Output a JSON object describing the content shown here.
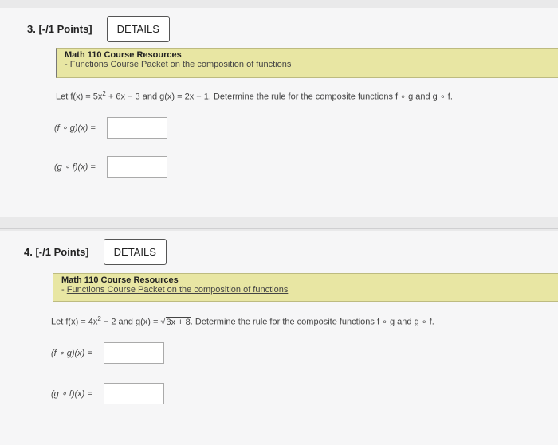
{
  "questions": [
    {
      "number": "3.",
      "points": "[-/1 Points]",
      "details_label": "DETAILS",
      "resources_title": "Math 110 Course Resources",
      "resources_prefix": "- ",
      "resources_link": "Functions Course Packet on the composition of functions",
      "prompt_pre": "Let f(x) = 5x",
      "prompt_sup": "2",
      "prompt_mid": " + 6x − 3 and g(x) = 2x − 1. Determine the rule for the composite functions f ∘ g and g ∘ f.",
      "answers": [
        {
          "label": "(f ∘ g)(x) =",
          "value": ""
        },
        {
          "label": "(g ∘ f)(x) =",
          "value": ""
        }
      ]
    },
    {
      "number": "4.",
      "points": "[-/1 Points]",
      "details_label": "DETAILS",
      "resources_title": "Math 110 Course Resources",
      "resources_prefix": "- ",
      "resources_link": "Functions Course Packet on the composition of functions",
      "prompt_pre": "Let f(x) = 4x",
      "prompt_sup": "2",
      "prompt_mid": " − 2 and g(x) = ",
      "prompt_radical": "√",
      "prompt_radicand": "3x + 8",
      "prompt_post": ". Determine the rule for the composite functions f ∘ g and g ∘ f.",
      "answers": [
        {
          "label": "(f ∘ g)(x) =",
          "value": ""
        },
        {
          "label": "(g ∘ f)(x) =",
          "value": ""
        }
      ]
    }
  ]
}
